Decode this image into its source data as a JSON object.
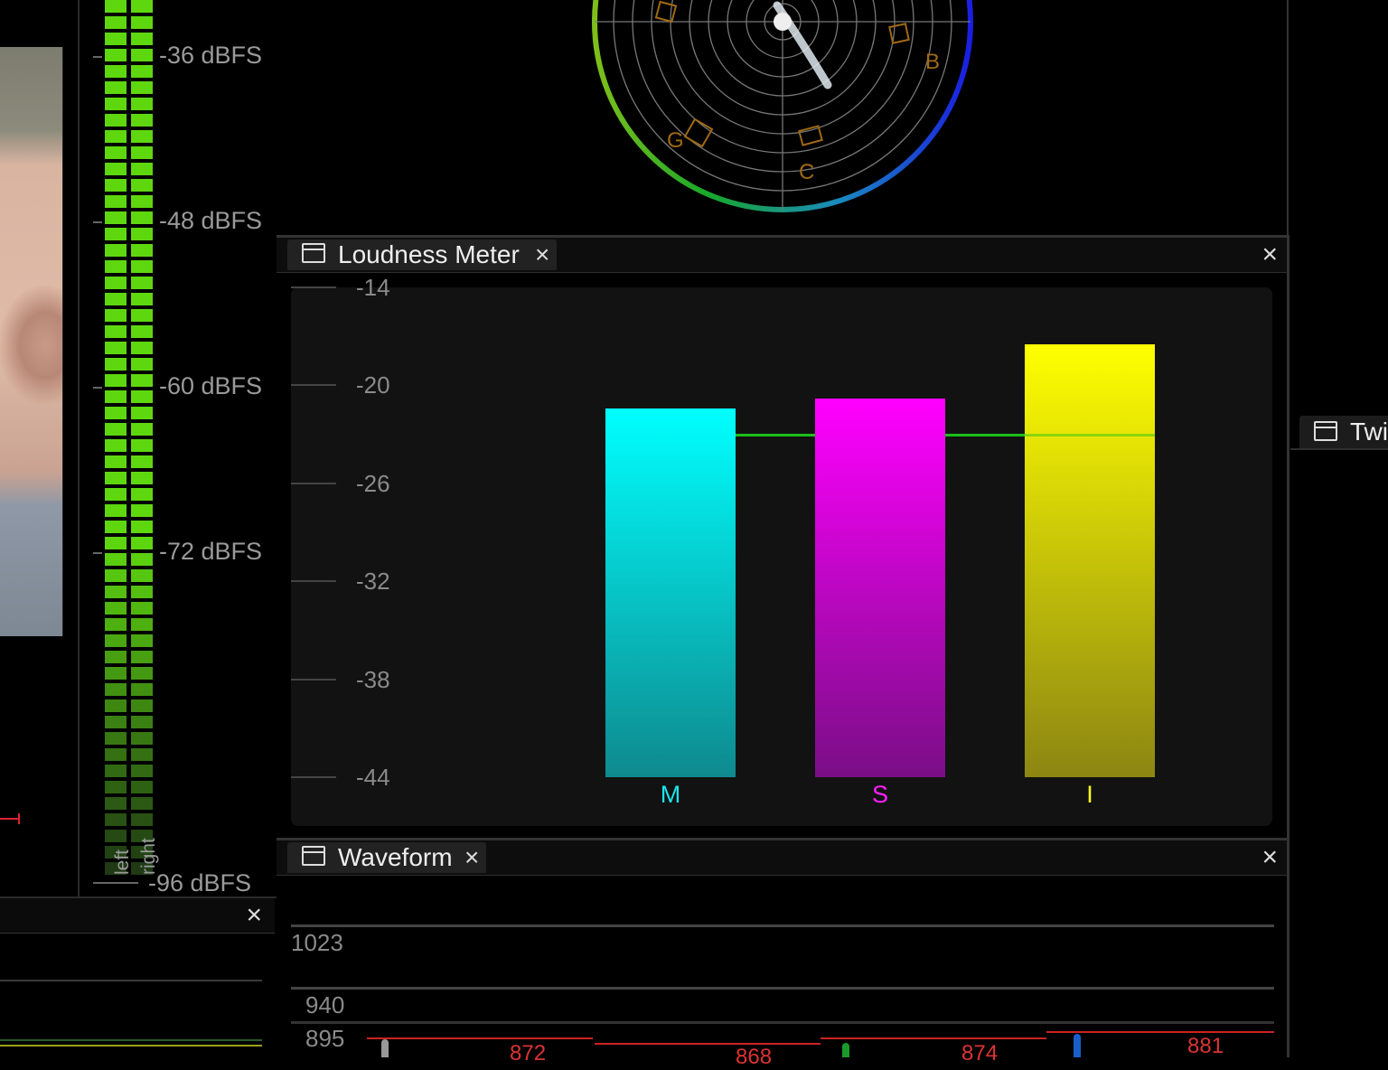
{
  "audio_meter": {
    "scale_labels": [
      "-36 dBFS",
      "-48 dBFS",
      "-60 dBFS",
      "-72 dBFS",
      "-96 dBFS"
    ],
    "channels": [
      "left",
      "right"
    ],
    "colors": {
      "bright": "#5ed70f",
      "dark": "#1f3a14"
    }
  },
  "vectorscope": {
    "markers": [
      "B",
      "G",
      "C"
    ],
    "ring_colors": [
      "#2e9a26",
      "#1aa25a",
      "#2070c0",
      "#1a2ae0"
    ]
  },
  "loudness": {
    "tab_title": "Loudness Meter",
    "tab_close": "×",
    "panel_close": "×",
    "chart_data": {
      "type": "bar",
      "categories": [
        "M",
        "S",
        "I"
      ],
      "values": [
        -21.4,
        -20.8,
        -17.5
      ],
      "target": -23,
      "ylim": [
        -44,
        -14
      ],
      "y_ticks": [
        "-14",
        "-20",
        "-26",
        "-32",
        "-38",
        "-44"
      ],
      "colors": [
        {
          "top": "#00ffff",
          "bottom": "#0e8a8e",
          "label": "#19e6f0"
        },
        {
          "top": "#ff00ff",
          "bottom": "#7a0e86",
          "label": "#ff20ff"
        },
        {
          "top": "#ffff00",
          "bottom": "#8c8612",
          "label": "#ffff20"
        }
      ],
      "target_color": "#1bbf1b"
    }
  },
  "waveform": {
    "tab_title": "Waveform",
    "tab_close": "×",
    "panel_close": "×",
    "levels": [
      "1023",
      "940",
      "895"
    ],
    "readouts": [
      "872",
      "868",
      "874",
      "881"
    ]
  },
  "bottom_left_panel": {
    "close": "×"
  },
  "right_panel": {
    "tab_title": "Twi"
  }
}
